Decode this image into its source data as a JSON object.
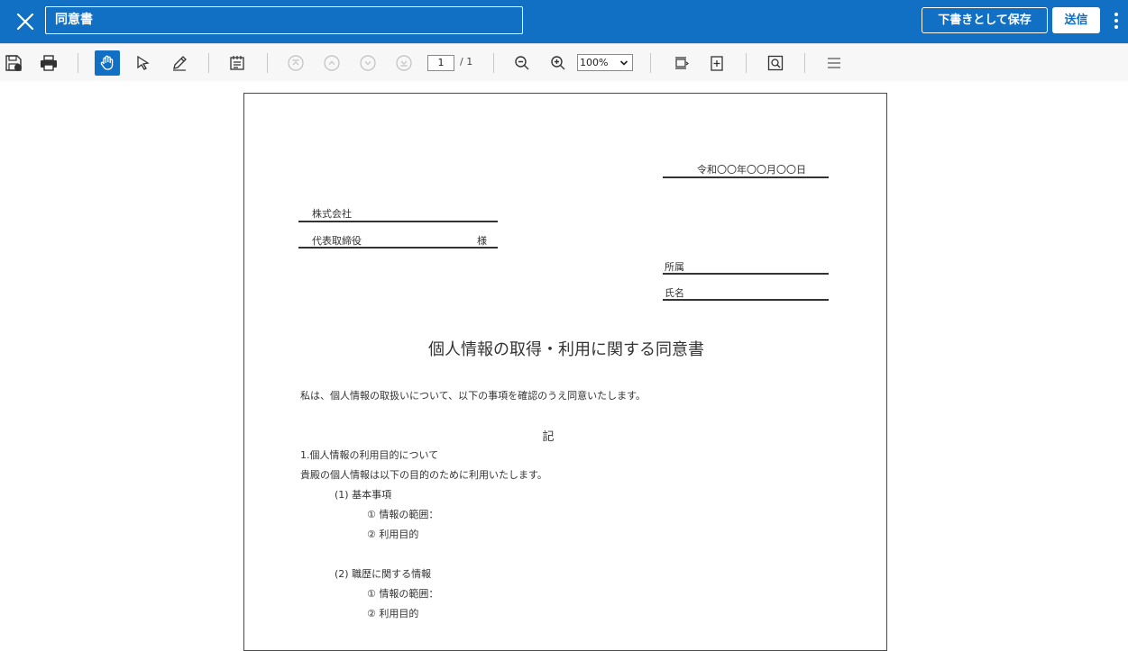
{
  "header": {
    "document_name": "同意書",
    "save_draft_label": "下書きとして保存",
    "send_label": "送信"
  },
  "toolbar": {
    "page_current": "1",
    "page_total": "/ 1",
    "zoom": "100%"
  },
  "document": {
    "date": "令和〇〇年〇〇月〇〇日",
    "company": "株式会社",
    "representative": "代表取締役",
    "honorific": "様",
    "affiliation_label": "所属",
    "name_label": "氏名",
    "title": "個人情報の取得・利用に関する同意書",
    "intro": "私は、個人情報の取扱いについて、以下の事項を確認のうえ同意いたします。",
    "ki": "記",
    "section1_heading": "1.個人情報の利用目的について",
    "section1_body": "貴殿の個人情報は以下の目的のために利用いたします。",
    "sub1_heading": "(1) 基本事項",
    "sub1_item1": "① 情報の範囲：",
    "sub1_item2": "② 利用目的",
    "sub2_heading": "(2) 職歴に関する情報",
    "sub2_item1": "① 情報の範囲：",
    "sub2_item2": "② 利用目的"
  }
}
